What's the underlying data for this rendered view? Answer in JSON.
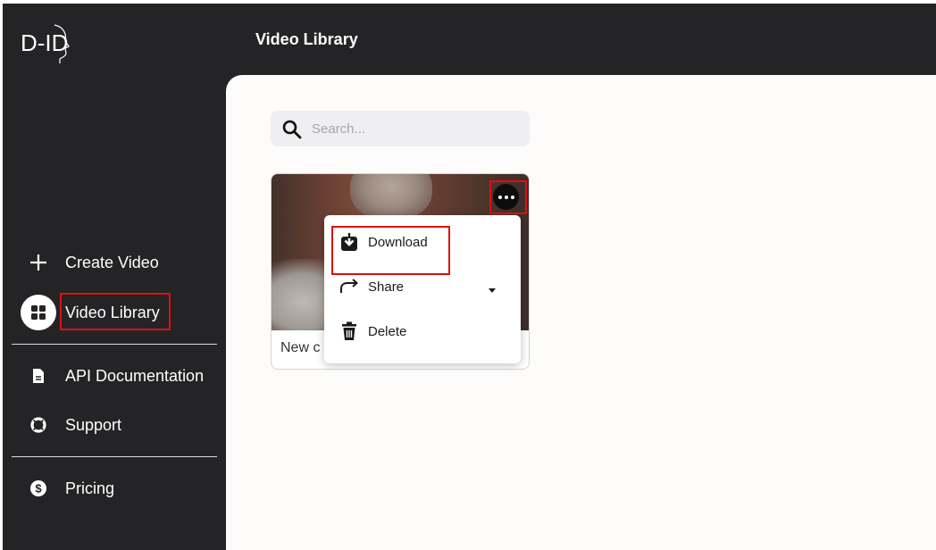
{
  "app": {
    "logo_text": "D-ID",
    "header_title": "Video Library"
  },
  "sidebar": {
    "create_video": "Create Video",
    "video_library": "Video Library",
    "api_documentation": "API Documentation",
    "support": "Support",
    "pricing": "Pricing"
  },
  "search": {
    "placeholder": "Search..."
  },
  "card": {
    "title": "New c"
  },
  "context_menu": {
    "download": "Download",
    "share": "Share",
    "delete": "Delete"
  },
  "colors": {
    "sidebar_bg": "#242426",
    "main_bg": "#fdfcfb",
    "highlight": "#e01010"
  }
}
